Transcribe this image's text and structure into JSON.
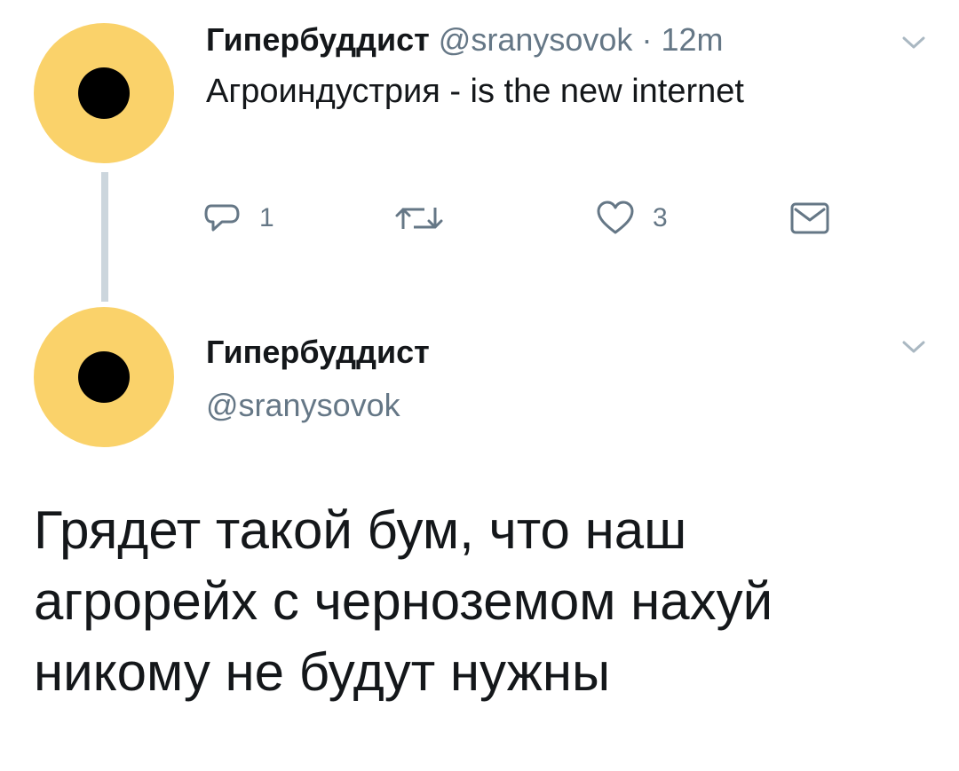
{
  "colors": {
    "avatar_bg": "#fad26a",
    "avatar_dot": "#000000",
    "thread_line": "#ccd6dd",
    "secondary_text": "#657786",
    "primary_text": "#14171a"
  },
  "tweet1": {
    "avatar_icon": "yellow-circle-with-black-dot",
    "name": "Гипербуддист",
    "handle": "@sranysovok",
    "separator": "·",
    "time": "12m",
    "text": "Агроиндустрия - is the new internet",
    "menu_icon": "chevron-down-icon",
    "actions": {
      "reply": {
        "icon": "reply-icon",
        "count": "1"
      },
      "retweet": {
        "icon": "retweet-icon",
        "count": ""
      },
      "like": {
        "icon": "heart-icon",
        "count": "3"
      },
      "direct_message": {
        "icon": "envelope-icon"
      }
    }
  },
  "tweet2": {
    "avatar_icon": "yellow-circle-with-black-dot",
    "name": "Гипербуддист",
    "handle": "@sranysovok",
    "menu_icon": "chevron-down-icon",
    "text_lines": [
      "Грядет такой бум, что наш",
      "агрорейх с черноземом нахуй",
      "никому не будут нужны"
    ]
  }
}
